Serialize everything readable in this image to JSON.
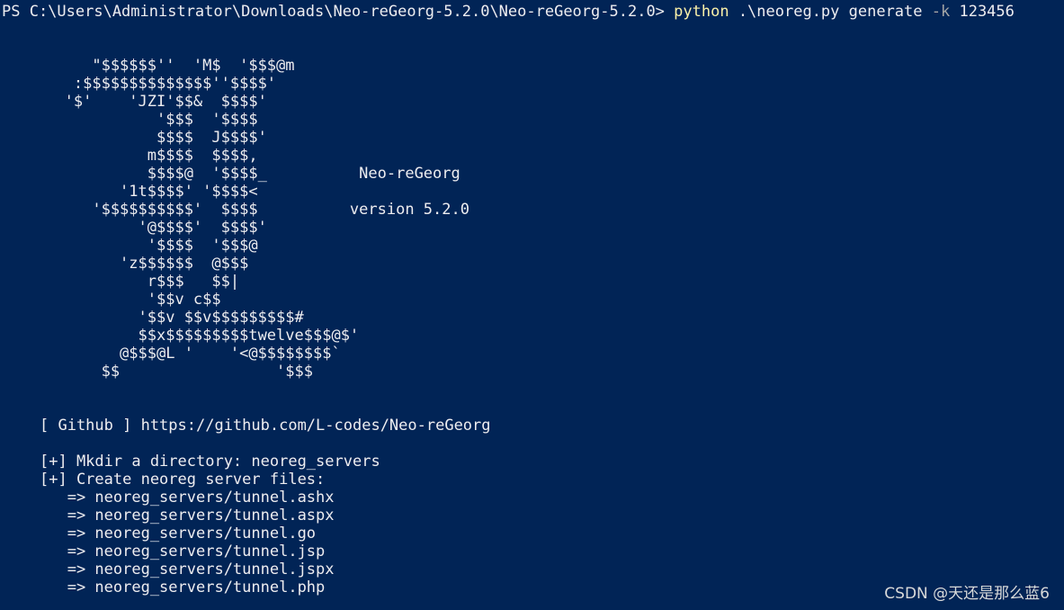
{
  "prompt": {
    "path": "PS C:\\Users\\Administrator\\Downloads\\Neo-reGeorg-5.2.0\\Neo-reGeorg-5.2.0> ",
    "executable": "python",
    "script": " .\\neoreg.py generate ",
    "flag": "-k",
    "value": " 123456"
  },
  "banner": {
    "lines": [
      "          \"$$$$$$''  'M$  '$$$@m",
      "        :$$$$$$$$$$$$$$''$$$$'",
      "       '$'    'JZI'$$&  $$$$'",
      "                 '$$$  '$$$$",
      "                 $$$$  J$$$$'",
      "                m$$$$  $$$$,",
      "                $$$$@  '$$$$_          Neo-reGeorg",
      "             '1t$$$$' '$$$$<",
      "          '$$$$$$$$$$'  $$$$          version 5.2.0",
      "               '@$$$$'  $$$$'",
      "                '$$$$  '$$$@",
      "             'z$$$$$$  @$$$",
      "                r$$$   $$|",
      "                '$$v c$$",
      "               '$$v $$v$$$$$$$$$#",
      "               $$x$$$$$$$$$twelve$$$@$'",
      "             @$$$@L '    '<@$$$$$$$$`",
      "           $$                 '$$$"
    ]
  },
  "github_line": "[ Github ] https://github.com/L-codes/Neo-reGeorg",
  "output": {
    "mkdir": "[+] Mkdir a directory: neoreg_servers",
    "create": "[+] Create neoreg server files:",
    "files": [
      "   => neoreg_servers/tunnel.ashx",
      "   => neoreg_servers/tunnel.aspx",
      "   => neoreg_servers/tunnel.go",
      "   => neoreg_servers/tunnel.jsp",
      "   => neoreg_servers/tunnel.jspx",
      "   => neoreg_servers/tunnel.php"
    ]
  },
  "watermark": "CSDN @天还是那么蓝6"
}
